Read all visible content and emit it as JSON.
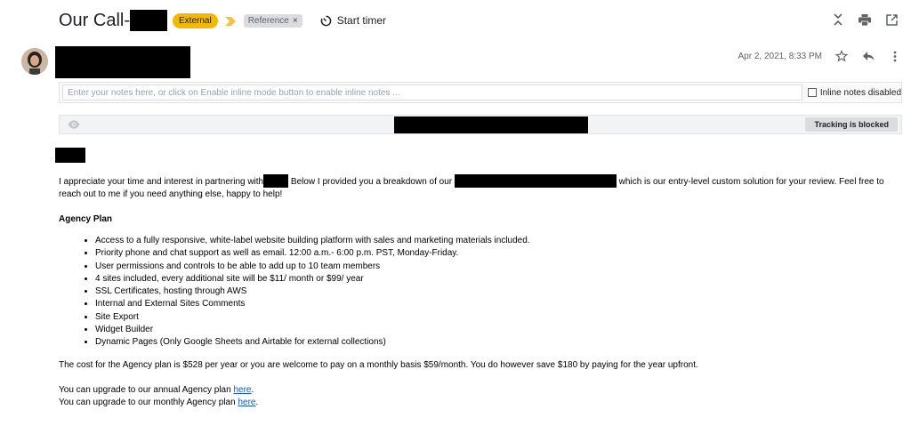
{
  "header": {
    "subject": "Our Call-",
    "badge": "External",
    "label": "Reference",
    "label_close": "×",
    "start_timer": "Start timer"
  },
  "message": {
    "date": "Apr 2, 2021, 8:33 PM"
  },
  "notes": {
    "placeholder": "Enter your notes here, or click on Enable inline mode button to enable inline notes ...",
    "inline_label": "Inline notes disabled"
  },
  "tracking": {
    "button": "Tracking is blocked"
  },
  "body": {
    "intro_part1": "I appreciate your time and interest in partnering with",
    "intro_part2": " Below I provided you a breakdown of our ",
    "intro_part3": " which is our entry-level custom solution for your review. Feel free to reach out to me if you need anything else, happy to help!",
    "plan_title": "Agency Plan",
    "features": [
      "Access to a fully responsive, white-label website building platform with sales and marketing materials included.",
      "Priority phone and chat support as well as email. 12:00 a.m.- 6:00 p.m. PST, Monday-Friday.",
      "User permissions and controls to be able to add up to 10 team members",
      "4 sites included, every additional site will be $11/ month or $99/ year",
      "SSL Certificates, hosting through AWS",
      "Internal and External Sites Comments",
      "Site Export",
      "Widget Builder",
      "Dynamic Pages (Only Google Sheets and Airtable for external collections)"
    ],
    "cost": "The cost for the Agency plan is $528 per year or you are welcome to pay on a monthly basis $59/month. You do however save $180 by paying for the year upfront.",
    "upgrade_annual_text": "You can upgrade to our annual Agency plan ",
    "upgrade_annual_link": "here",
    "upgrade_monthly_text": "You can upgrade to our monthly Agency plan ",
    "upgrade_monthly_link": "here",
    "period": "."
  },
  "icons": {
    "importance": "importance-arrow-icon",
    "timer": "timer-icon",
    "collapse": "collapse-all-icon",
    "print": "print-icon",
    "popout": "open-new-window-icon",
    "star": "star-icon",
    "reply": "reply-icon",
    "more": "more-vertical-icon",
    "eye": "eye-icon"
  },
  "colors": {
    "external_badge": "#f5b800",
    "link": "#1155cc",
    "redaction": "#000000"
  }
}
